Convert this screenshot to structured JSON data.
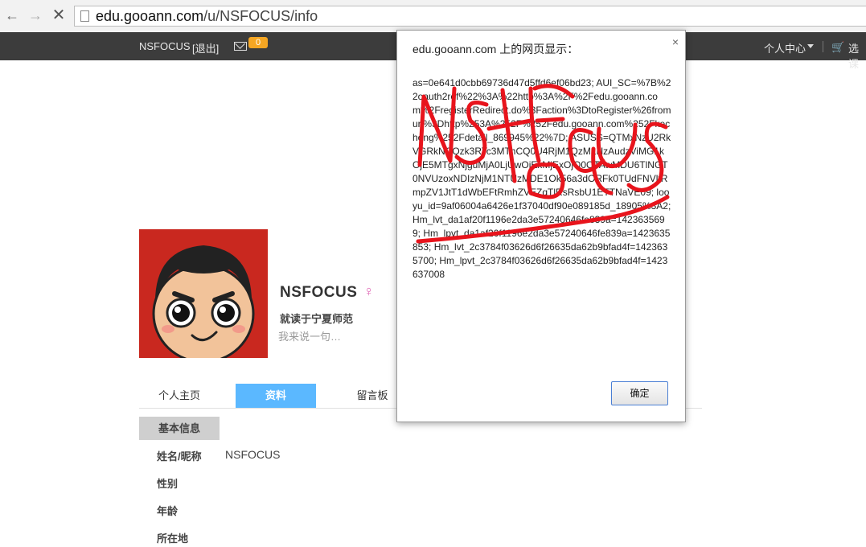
{
  "browser": {
    "url_host": "edu.gooann.com",
    "url_path": "/u/NSFOCUS/info"
  },
  "topbar": {
    "username": "NSFOCUS",
    "logout": "[退出]",
    "mail_count": "0",
    "user_center": "个人中心",
    "course_select": "选课"
  },
  "profile": {
    "nickname": "NSFOCUS",
    "gender_symbol": "♀",
    "school": "就读于宁夏师范",
    "motto": "我来说一句…"
  },
  "tabs": [
    {
      "label": "个人主页"
    },
    {
      "label": "资料"
    },
    {
      "label": "留言板"
    }
  ],
  "info": {
    "section": "基本信息",
    "rows": [
      {
        "label": "姓名/昵称",
        "value": "NSFOCUS"
      },
      {
        "label": "性别",
        "value": ""
      },
      {
        "label": "年龄",
        "value": ""
      },
      {
        "label": "所在地",
        "value": ""
      }
    ]
  },
  "dialog": {
    "title": "edu.gooann.com 上的网页显示：",
    "close": "×",
    "message": "as=0e641d0cbb69736d47d5ffd6ef06bd23; AUI_SC=%7B%22oauth2ref%22%3A%22http%3A%2F%2Fedu.gooann.com%2FregisterRedirect.do%3Faction%3DtoRegister%26fromurl%3Dhttp%253A%252F%252Fedu.gooann.com%252Fkecheng%252Fdetail_869945%22%7D; ASUSS=QTMxNzU2RkVGRkNCQzk3RTc3MThCQ0U4RjM1QzM1NzAudzViMG1kOjE5MTgxNjguMjA0LjUwOjExMjExOjQ0OTAwMDU6TlNGT0NVUzoxNDIzNjM1NTUzMDE1Ok56a3dORFk0TUdFNVltRmpZV1JtT1dWbEFtRmhZVEZqTlRsRsbU1ETTNaVE09; looyu_id=9af06004a6426e1f37040df90e089185d_18905%3A2; Hm_lvt_da1af20f1196e2da3e57240646fe839a=1423635699; Hm_lpvt_da1af20f1196e2da3e57240646fe839a=1423635853; Hm_lvt_2c3784f03626d6f26635da62b9bfad4f=1423635700; Hm_lpvt_2c3784f03626d6f26635da62b9bfad4f=1423637008",
    "ok": "确定"
  },
  "colors": {
    "topbar_bg": "#3c3c3c",
    "tab_active": "#5bb8ff",
    "badge": "#f5a623",
    "scrawl": "#e8141c"
  }
}
